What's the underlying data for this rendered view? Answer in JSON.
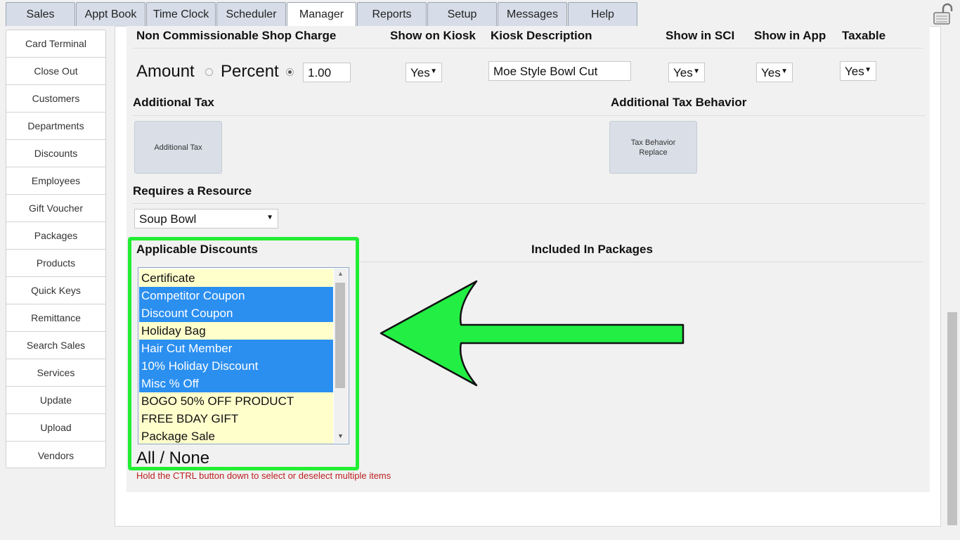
{
  "tabs": [
    {
      "label": "Sales"
    },
    {
      "label": "Appt Book"
    },
    {
      "label": "Time Clock"
    },
    {
      "label": "Scheduler"
    },
    {
      "label": "Manager",
      "active": true
    },
    {
      "label": "Reports"
    },
    {
      "label": "Setup"
    },
    {
      "label": "Messages"
    },
    {
      "label": "Help"
    }
  ],
  "sidebar": {
    "items": [
      {
        "label": "Card Terminal"
      },
      {
        "label": "Close Out"
      },
      {
        "label": "Customers"
      },
      {
        "label": "Departments"
      },
      {
        "label": "Discounts"
      },
      {
        "label": "Employees"
      },
      {
        "label": "Gift Voucher"
      },
      {
        "label": "Packages"
      },
      {
        "label": "Products"
      },
      {
        "label": "Quick Keys"
      },
      {
        "label": "Remittance"
      },
      {
        "label": "Search Sales"
      },
      {
        "label": "Services"
      },
      {
        "label": "Update"
      },
      {
        "label": "Upload"
      },
      {
        "label": "Vendors"
      }
    ]
  },
  "form": {
    "shop_charge_label": "Non Commissionable Shop Charge",
    "show_kiosk_label": "Show on Kiosk",
    "kiosk_desc_label": "Kiosk Description",
    "show_sci_label": "Show in SCI",
    "show_app_label": "Show in App",
    "taxable_label": "Taxable",
    "amount_label": "Amount",
    "percent_label": "Percent",
    "charge_value": "1.00",
    "show_kiosk_value": "Yes",
    "kiosk_desc_value": "Moe Style Bowl Cut",
    "show_sci_value": "Yes",
    "show_app_value": "Yes",
    "taxable_value": "Yes",
    "additional_tax_label": "Additional Tax",
    "additional_tax_button": "Additional Tax",
    "tax_behavior_label": "Additional Tax Behavior",
    "tax_behavior_line1": "Tax Behavior",
    "tax_behavior_line2": "Replace",
    "requires_resource_label": "Requires a Resource",
    "resource_value": "Soup Bowl",
    "applicable_discounts_label": "Applicable Discounts",
    "included_packages_label": "Included In Packages",
    "all_none_label": "All / None",
    "hint": "Hold the CTRL button down to select or deselect multiple items"
  },
  "discounts": [
    {
      "label": "Certificate",
      "selected": false
    },
    {
      "label": "Competitor Coupon",
      "selected": true
    },
    {
      "label": "Discount Coupon",
      "selected": true
    },
    {
      "label": "Holiday Bag",
      "selected": false
    },
    {
      "label": "Hair Cut Member",
      "selected": true
    },
    {
      "label": "10% Holiday Discount",
      "selected": true
    },
    {
      "label": "Misc % Off",
      "selected": true
    },
    {
      "label": "BOGO 50% OFF PRODUCT",
      "selected": false
    },
    {
      "label": "FREE BDAY GIFT",
      "selected": false
    },
    {
      "label": "Package Sale",
      "selected": false
    }
  ],
  "colors": {
    "highlight": "#2b8ff0",
    "option_bg": "#ffffcc",
    "annotation_green": "#22ee33"
  }
}
